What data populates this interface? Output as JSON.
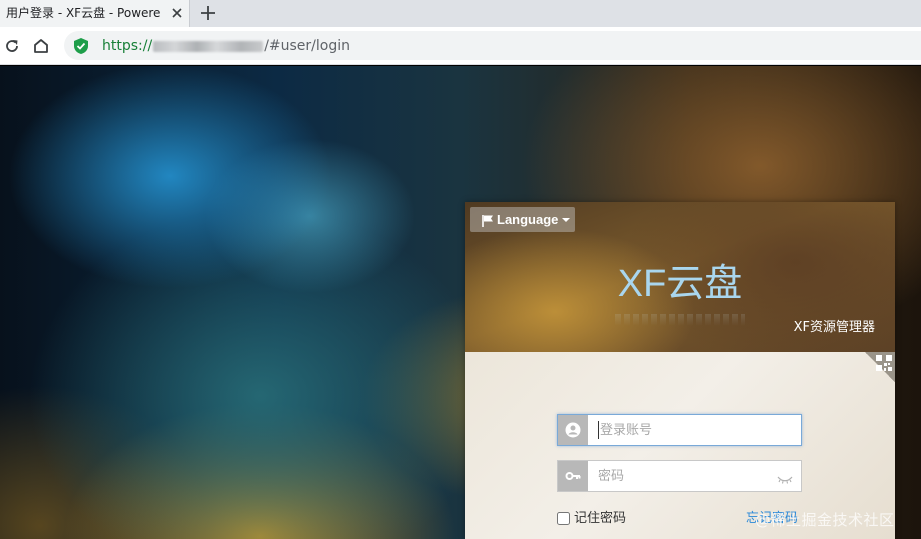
{
  "browser": {
    "tab_title": "用户登录 - XF云盘 - Powere",
    "url_scheme": "https://",
    "url_path": "/#user/login"
  },
  "login": {
    "language_label": "Language",
    "brand_name": "XF云盘",
    "subtitle": "XF资源管理器",
    "account_placeholder": "登录账号",
    "password_placeholder": "密码",
    "remember_label": "记住密码",
    "forgot_label": "忘记密码"
  },
  "watermark": "@稀土掘金技术社区",
  "colors": {
    "brand_text": "#a9d6ee",
    "link": "#2a88d8",
    "secure": "#188038"
  }
}
